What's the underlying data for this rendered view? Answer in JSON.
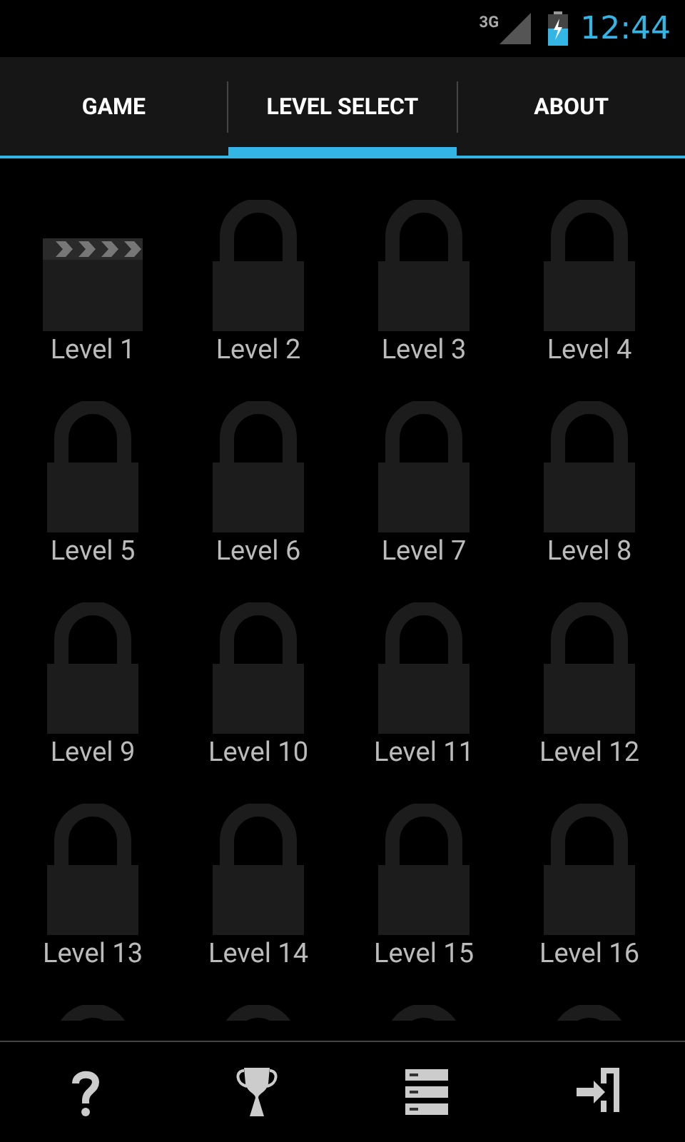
{
  "status_bar": {
    "network": "3G",
    "time": "12:44"
  },
  "tabs": [
    {
      "label": "GAME",
      "selected": false
    },
    {
      "label": "LEVEL SELECT",
      "selected": true
    },
    {
      "label": "ABOUT",
      "selected": false
    }
  ],
  "levels": [
    {
      "kind": "clapper",
      "label": "Level 1"
    },
    {
      "kind": "locked",
      "label": "Level 2"
    },
    {
      "kind": "locked",
      "label": "Level 3"
    },
    {
      "kind": "locked",
      "label": "Level 4"
    },
    {
      "kind": "locked",
      "label": "Level 5"
    },
    {
      "kind": "locked",
      "label": "Level 6"
    },
    {
      "kind": "locked",
      "label": "Level 7"
    },
    {
      "kind": "locked",
      "label": "Level 8"
    },
    {
      "kind": "locked",
      "label": "Level 9"
    },
    {
      "kind": "locked",
      "label": "Level 10"
    },
    {
      "kind": "locked",
      "label": "Level 11"
    },
    {
      "kind": "locked",
      "label": "Level 12"
    },
    {
      "kind": "locked",
      "label": "Level 13"
    },
    {
      "kind": "locked",
      "label": "Level 14"
    },
    {
      "kind": "locked",
      "label": "Level 15"
    },
    {
      "kind": "locked",
      "label": "Level 16"
    },
    {
      "kind": "locked"
    },
    {
      "kind": "locked"
    },
    {
      "kind": "locked"
    },
    {
      "kind": "locked"
    }
  ],
  "bottom_bar": [
    {
      "kind": "help"
    },
    {
      "kind": "trophy"
    },
    {
      "kind": "list"
    },
    {
      "kind": "exit"
    }
  ]
}
